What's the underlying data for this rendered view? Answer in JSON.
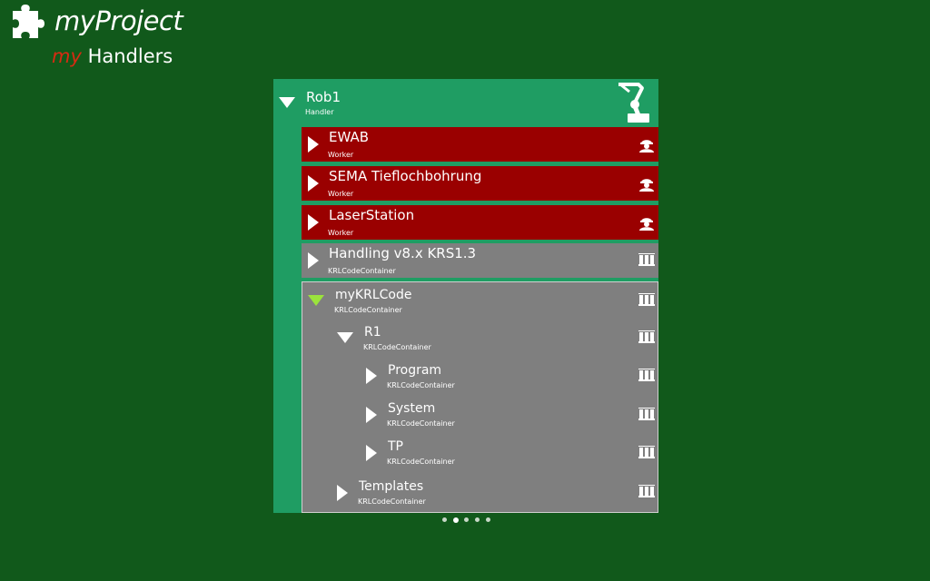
{
  "header": {
    "app_title": "myProject",
    "subtitle_prefix": "my",
    "subtitle_rest": " Handlers"
  },
  "handler": {
    "name": "Rob1",
    "type": "Handler"
  },
  "workers": [
    {
      "name": "EWAB",
      "type": "Worker"
    },
    {
      "name": "SEMA Tieflochbohrung",
      "type": "Worker"
    },
    {
      "name": "LaserStation",
      "type": "Worker"
    }
  ],
  "containers": [
    {
      "name": "Handling v8.x KRS1.3",
      "type": "KRLCodeContainer"
    }
  ],
  "tree": {
    "root": {
      "name": "myKRLCode",
      "type": "KRLCodeContainer"
    },
    "r1": {
      "name": "R1",
      "type": "KRLCodeContainer"
    },
    "program": {
      "name": "Program",
      "type": "KRLCodeContainer"
    },
    "system": {
      "name": "System",
      "type": "KRLCodeContainer"
    },
    "tp": {
      "name": "TP",
      "type": "KRLCodeContainer"
    },
    "templates": {
      "name": "Templates",
      "type": "KRLCodeContainer"
    }
  },
  "icons": {
    "app_logo": "puzzle-piece-icon",
    "handler": "robot-arm-icon",
    "worker": "worker-helmet-icon",
    "container": "code-container-icon"
  },
  "pager": {
    "count": 5,
    "active": 2
  },
  "colors": {
    "background": "#11591b",
    "panel": "#1f9d63",
    "worker": "#9a0000",
    "container": "#7f7f7f",
    "accent_my": "#d52b12",
    "expanded_arrow": "#9be33c"
  }
}
